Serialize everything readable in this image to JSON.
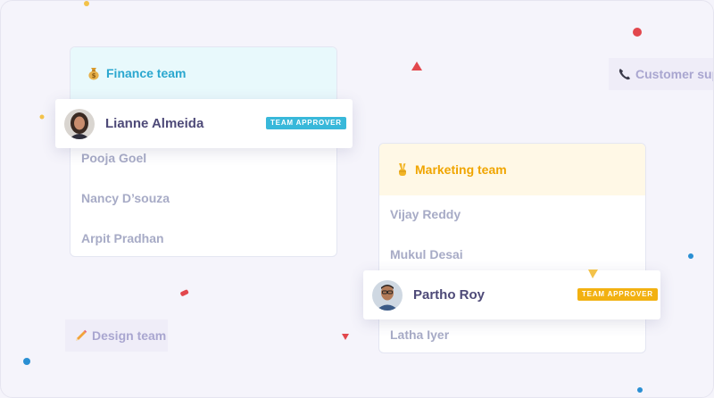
{
  "finance_team": {
    "title": "Finance team",
    "icon": "money-bag-icon",
    "accent": "#2aa7cf",
    "header_bg": "#e8f9fc",
    "approver": {
      "name": "Lianne Almeida",
      "badge": "TEAM APPROVER",
      "badge_color": "#38b8da"
    },
    "members": [
      "Pooja Goel",
      "Nancy D’souza",
      "Arpit Pradhan"
    ]
  },
  "marketing_team": {
    "title": "Marketing team",
    "icon": "victory-hand-icon",
    "accent": "#f0a500",
    "header_bg": "#fff8e6",
    "approver": {
      "name": "Partho Roy",
      "badge": "TEAM APPROVER",
      "badge_color": "#f2b111"
    },
    "members": [
      "Vijay Reddy",
      "Mukul Desai",
      "Latha Iyer"
    ]
  },
  "other_teams": {
    "customer_support": {
      "label": "Customer supp",
      "icon": "telephone-icon"
    },
    "design": {
      "label": "Design team",
      "icon": "pencil-icon"
    }
  }
}
